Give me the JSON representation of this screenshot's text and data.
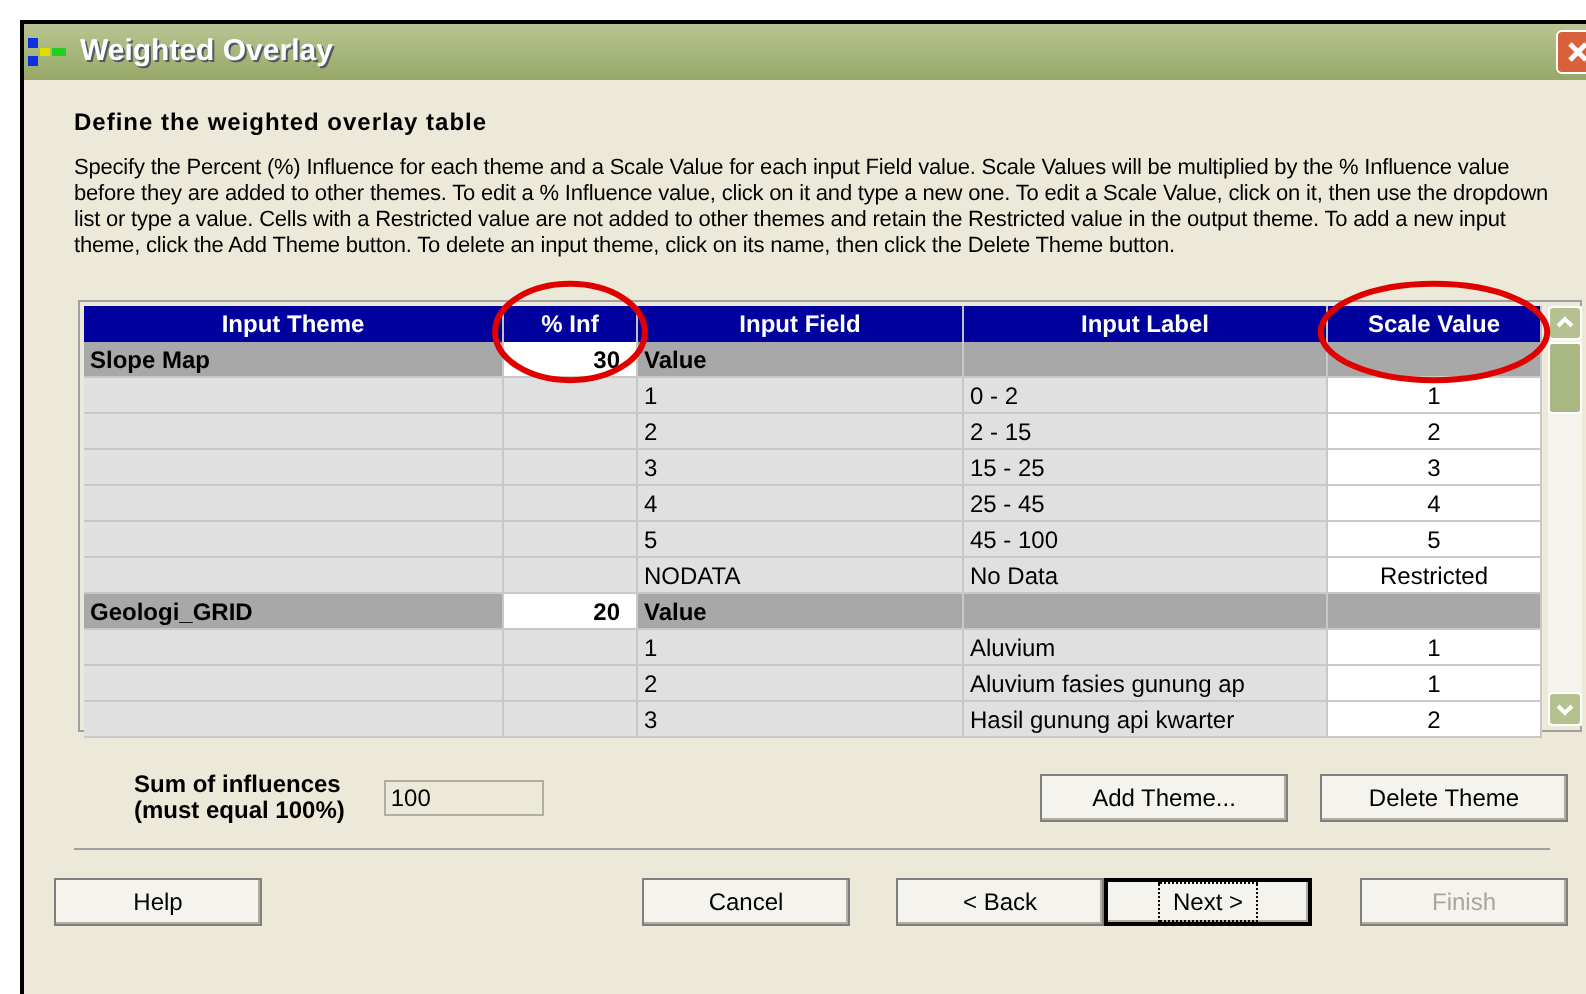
{
  "window": {
    "title": "Weighted Overlay"
  },
  "heading": "Define the weighted overlay table",
  "instructions": "Specify the Percent (%) Influence for each theme and a Scale Value for each input Field value. Scale Values will be multiplied by the % Influence value before they are added to other themes. To edit a % Influence value, click on it and type a new one. To edit a Scale Value, click on it, then use the dropdown list or type a value. Cells with a Restricted value are not added to other themes and retain the Restricted value in the output theme. To add a new input theme, click the Add Theme button. To delete an input theme, click on its name, then click the Delete Theme button.",
  "table": {
    "columns": [
      {
        "label": "Input Theme",
        "circled": false
      },
      {
        "label": "% Inf",
        "circled": true
      },
      {
        "label": "Input Field",
        "circled": false
      },
      {
        "label": "Input Label",
        "circled": false
      },
      {
        "label": "Scale Value",
        "circled": true
      }
    ],
    "rows": [
      {
        "kind": "theme",
        "theme": "Slope Map",
        "influence": "30",
        "field": "Value"
      },
      {
        "kind": "value",
        "field": "1",
        "label": "0 - 2",
        "scale": "1"
      },
      {
        "kind": "value",
        "field": "2",
        "label": "2 - 15",
        "scale": "2"
      },
      {
        "kind": "value",
        "field": "3",
        "label": "15 - 25",
        "scale": "3"
      },
      {
        "kind": "value",
        "field": "4",
        "label": "25 - 45",
        "scale": "4"
      },
      {
        "kind": "value",
        "field": "5",
        "label": "45 - 100",
        "scale": "5"
      },
      {
        "kind": "value",
        "field": "NODATA",
        "label": "No Data",
        "scale": "Restricted"
      },
      {
        "kind": "theme",
        "theme": "Geologi_GRID",
        "influence": "20",
        "field": "Value"
      },
      {
        "kind": "value",
        "field": "1",
        "label": "Aluvium",
        "scale": "1"
      },
      {
        "kind": "value",
        "field": "2",
        "label": "Aluvium fasies gunung ap",
        "scale": "1"
      },
      {
        "kind": "value",
        "field": "3",
        "label": "Hasil gunung api kwarter",
        "scale": "2"
      }
    ]
  },
  "sum": {
    "label_line1": "Sum of influences",
    "label_line2": "(must equal 100%)",
    "value": "100"
  },
  "theme_buttons": [
    {
      "label": "Add Theme...",
      "disabled": false,
      "default": false
    },
    {
      "label": "Delete Theme",
      "disabled": false,
      "default": false
    }
  ],
  "nav_buttons": [
    {
      "label": "Help",
      "disabled": false,
      "default": false
    },
    {
      "label": "Cancel",
      "disabled": false,
      "default": false
    },
    {
      "label": "< Back",
      "disabled": false,
      "default": false
    },
    {
      "label": "Next >",
      "disabled": false,
      "default": true
    },
    {
      "label": "Finish",
      "disabled": true,
      "default": false
    }
  ]
}
